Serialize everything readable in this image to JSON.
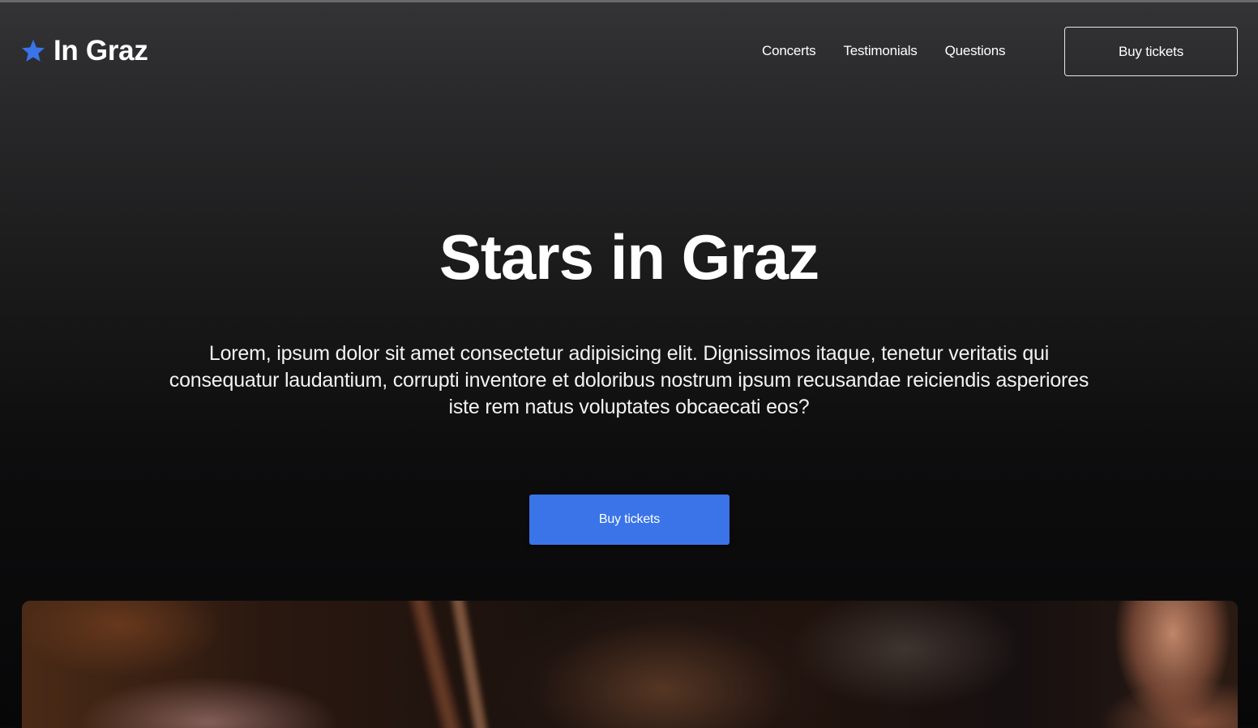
{
  "brand": {
    "name": "In Graz",
    "icon": "star-icon",
    "accent_color": "#3a74e8"
  },
  "nav": {
    "items": [
      {
        "label": "Concerts"
      },
      {
        "label": "Testimonials"
      },
      {
        "label": "Questions"
      }
    ],
    "cta_label": "Buy tickets"
  },
  "hero": {
    "title": "Stars in Graz",
    "description": "Lorem, ipsum dolor sit amet consectetur adipisicing elit. Dignissimos itaque, tenetur veritatis qui consequatur laudantium, corrupti inventore et doloribus nostrum ipsum recusandae reiciendis asperiores iste rem natus voluptates obcaecati eos?",
    "cta_label": "Buy tickets",
    "cta_color": "#3a74e8"
  }
}
